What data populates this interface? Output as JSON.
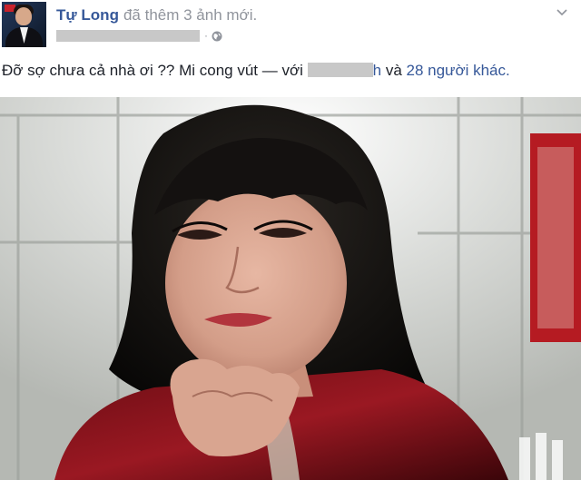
{
  "post": {
    "author": {
      "name": "Tự Long",
      "action": "đã thêm 3 ảnh mới."
    },
    "meta": {
      "separator": "·",
      "privacy_icon": "globe-icon"
    },
    "caption": {
      "text": "Đỡ sợ chưa cả nhà ơi ?? Mi cong vút — với",
      "tag_suffix": "h",
      "conjunction": "và",
      "others_link": "28 người khác."
    },
    "menu_icon": "chevron-down-icon",
    "photo": {
      "subject": "portrait-photo"
    }
  },
  "colors": {
    "link": "#365899",
    "text": "#1d2129",
    "meta": "#90949c",
    "redaction": "#c8c8c8"
  }
}
